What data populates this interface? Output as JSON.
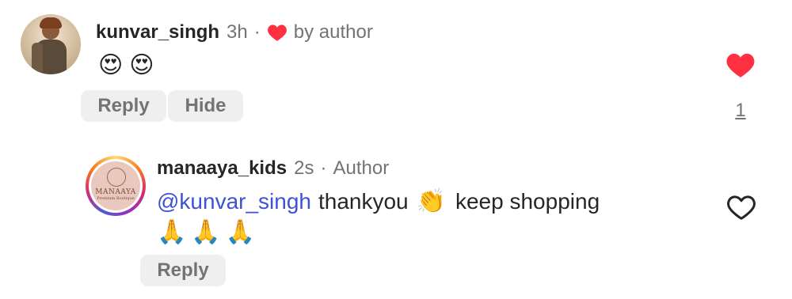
{
  "comment": {
    "username": "kunvar_singh",
    "time": "3h",
    "separator": "·",
    "liked_by_author": "by author",
    "text_emojis": [
      "😍",
      "😍"
    ],
    "reply_label": "Reply",
    "hide_label": "Hide",
    "like_count": "1"
  },
  "reply": {
    "username": "manaaya_kids",
    "time": "2s",
    "separator": "·",
    "author_badge": "Author",
    "mention": "@kunvar_singh",
    "text_part1": "thankyou",
    "clap_emoji": "👏",
    "text_part2": "keep shopping",
    "pray_emojis": [
      "🙏",
      "🙏",
      "🙏"
    ],
    "reply_label": "Reply",
    "avatar_logo": "MANAAYA",
    "avatar_sub": "Premium Boutique"
  },
  "colors": {
    "like_red": "#ff3040",
    "mention_blue": "#3d52d5",
    "muted": "#737373",
    "pill_bg": "#efefef"
  }
}
